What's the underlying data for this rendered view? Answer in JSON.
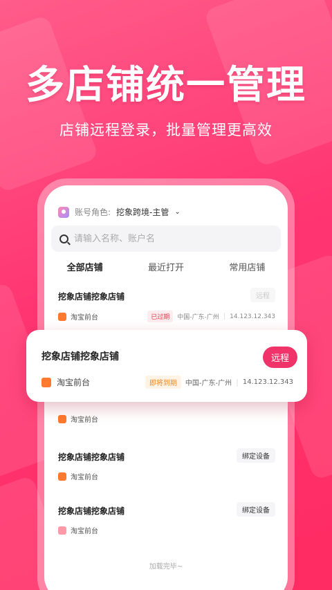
{
  "headline": "多店铺统一管理",
  "subheadline": "店铺远程登录，批量管理更高效",
  "role": {
    "label": "账号角色:",
    "value": "挖象跨境-主管"
  },
  "search": {
    "placeholder": "请输入名称、账户名"
  },
  "tabs": [
    {
      "label": "全部店铺",
      "active": true
    },
    {
      "label": "最近打开",
      "active": false
    },
    {
      "label": "常用店铺",
      "active": false
    }
  ],
  "stores": [
    {
      "name": "挖象店铺挖象店铺",
      "platform": "淘宝前台",
      "status": "已过期",
      "region": "中国-广东-广州",
      "ip": "14.123.12.343",
      "action": "远程"
    },
    {
      "name": "挖象店铺挖象店铺",
      "platform": "淘宝前台",
      "status": "即将到期",
      "region": "中国-广东-广州",
      "ip": "14.123.12.343",
      "action": "远程"
    },
    {
      "name": "",
      "platform": "淘宝前台"
    },
    {
      "name": "挖象店铺挖象店铺",
      "platform": "淘宝前台",
      "action": "绑定设备"
    },
    {
      "name": "挖象店铺挖象店铺",
      "platform": "淘宝前台",
      "action": "绑定设备"
    }
  ],
  "footer": "加载完毕~",
  "colors": {
    "brand": "#f0346a",
    "expired": "#e8364b",
    "expiring": "#f08a2c",
    "background": "#ff3572"
  }
}
